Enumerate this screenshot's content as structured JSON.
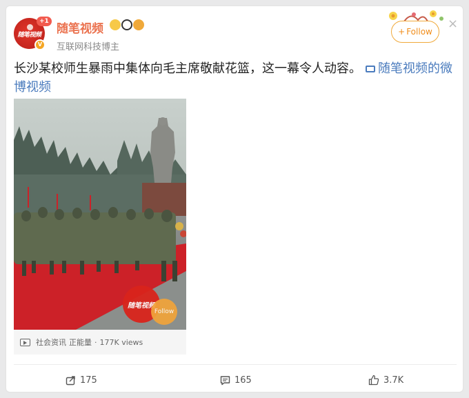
{
  "author": {
    "name": "随笔视频",
    "subtitle": "互联网科技博主",
    "avatar_text": "随笔视频",
    "avatar_badge": "+1",
    "verified_badge": "V"
  },
  "header": {
    "follow_label": "Follow",
    "follow_plus": "+"
  },
  "post": {
    "text": "长沙某校师生暴雨中集体向毛主席敬献花篮，这一幕令人动容。",
    "link_text": "随笔视频的微博视频"
  },
  "video": {
    "watermark_text": "随笔视频",
    "watermark_follow": "Follow",
    "meta_category": "社会资讯",
    "meta_tag": "正能量",
    "meta_separator": "·",
    "meta_views": "177K views"
  },
  "actions": {
    "share_count": "175",
    "comment_count": "165",
    "like_count": "3.7K"
  },
  "colors": {
    "accent_orange": "#eb7350",
    "link_blue": "#4a7bbd",
    "follow_orange": "#f08c19",
    "carpet_red": "#cc2128"
  }
}
